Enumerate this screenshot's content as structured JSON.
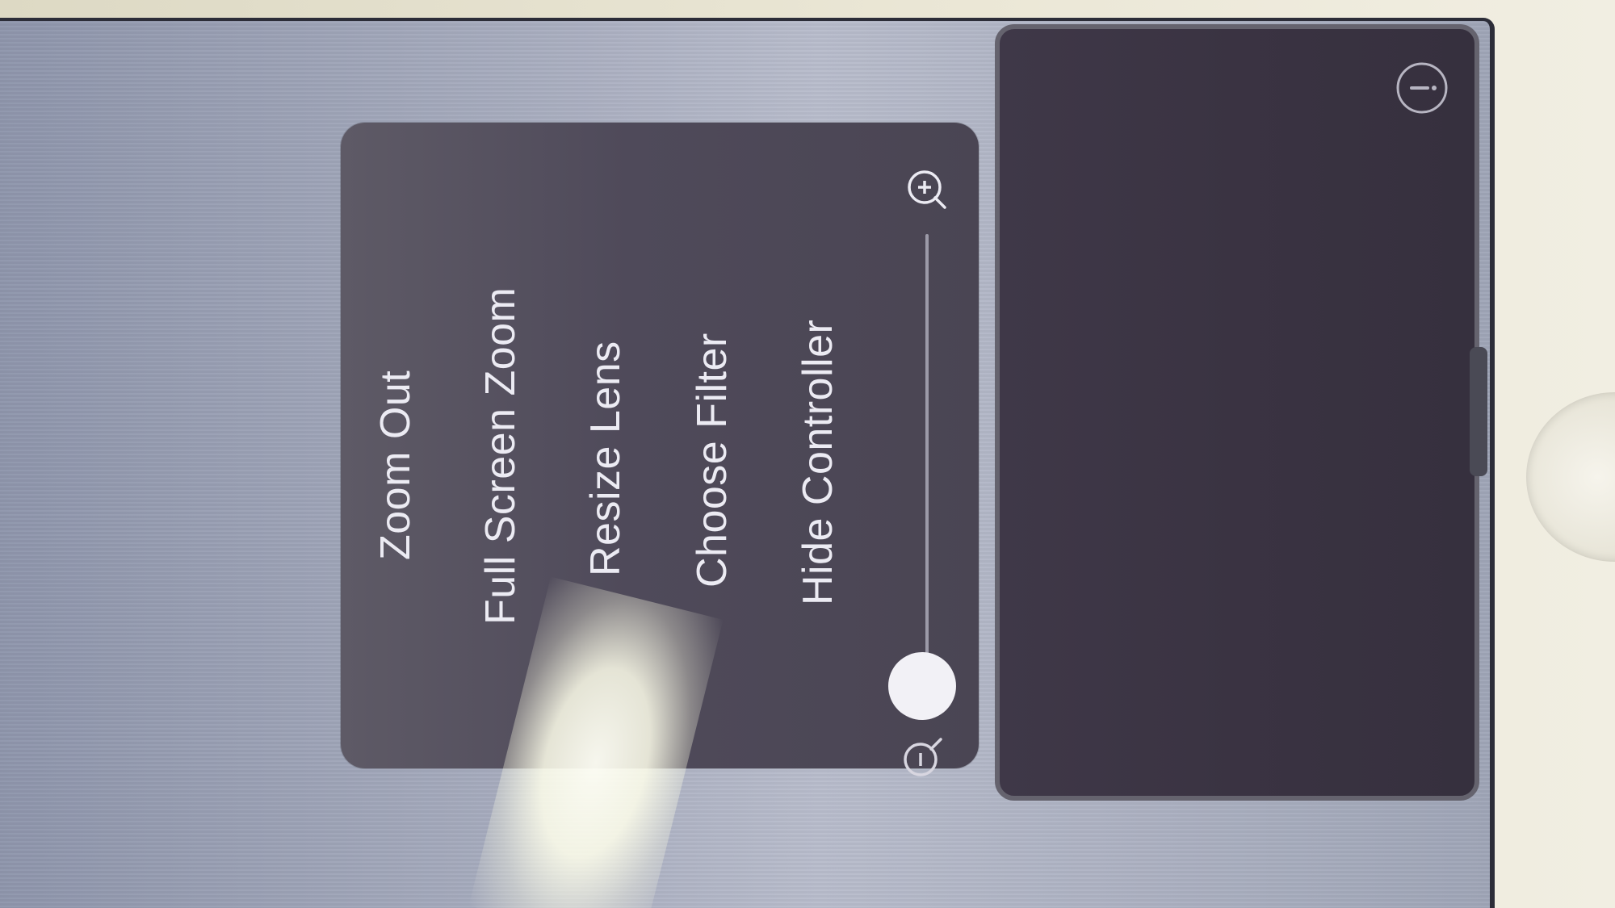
{
  "zoom_menu": {
    "items": [
      {
        "label": "Zoom Out"
      },
      {
        "label": "Full Screen Zoom"
      },
      {
        "label": "Resize Lens"
      },
      {
        "label": "Choose Filter"
      },
      {
        "label": "Hide Controller"
      }
    ],
    "zoom_slider": {
      "level": 0.1,
      "min_icon": "zoom-out-icon",
      "max_icon": "zoom-in-icon"
    }
  },
  "side_panel": {
    "icon": "info-icon"
  },
  "colors": {
    "screen": "#a8adbf",
    "menu_background": "#4f4a5a",
    "menu_text": "#ecebf3",
    "side_panel": "#3a3342"
  }
}
